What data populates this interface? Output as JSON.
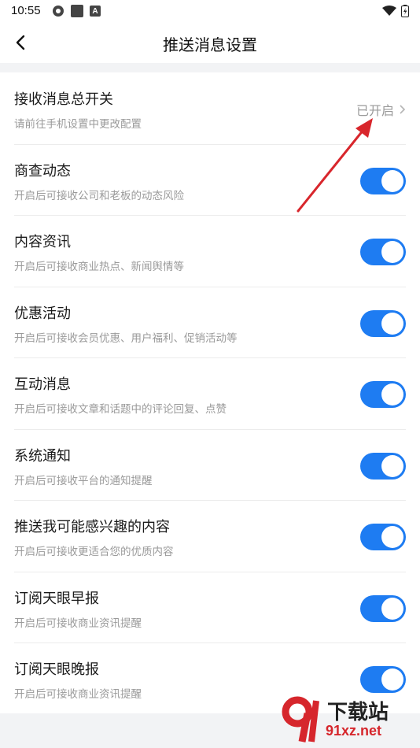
{
  "status_bar": {
    "time": "10:55"
  },
  "nav": {
    "title": "推送消息设置"
  },
  "master": {
    "title": "接收消息总开关",
    "subtitle": "请前往手机设置中更改配置",
    "status": "已开启"
  },
  "items": [
    {
      "title": "商查动态",
      "subtitle": "开启后可接收公司和老板的动态风险",
      "on": true
    },
    {
      "title": "内容资讯",
      "subtitle": "开启后可接收商业热点、新闻舆情等",
      "on": true
    },
    {
      "title": "优惠活动",
      "subtitle": "开启后可接收会员优惠、用户福利、促销活动等",
      "on": true
    },
    {
      "title": "互动消息",
      "subtitle": "开启后可接收文章和话题中的评论回复、点赞",
      "on": true
    },
    {
      "title": "系统通知",
      "subtitle": "开启后可接收平台的通知提醒",
      "on": true
    },
    {
      "title": "推送我可能感兴趣的内容",
      "subtitle": "开启后可接收更适合您的优质内容",
      "on": true
    },
    {
      "title": "订阅天眼早报",
      "subtitle": "开启后可接收商业资讯提醒",
      "on": true
    },
    {
      "title": "订阅天眼晚报",
      "subtitle": "开启后可接收商业资讯提醒",
      "on": true
    }
  ],
  "colors": {
    "toggle_on": "#1e7cf2",
    "annotation_arrow": "#d8262c"
  },
  "watermark": {
    "text": "下载站",
    "url": "91xz.net"
  }
}
